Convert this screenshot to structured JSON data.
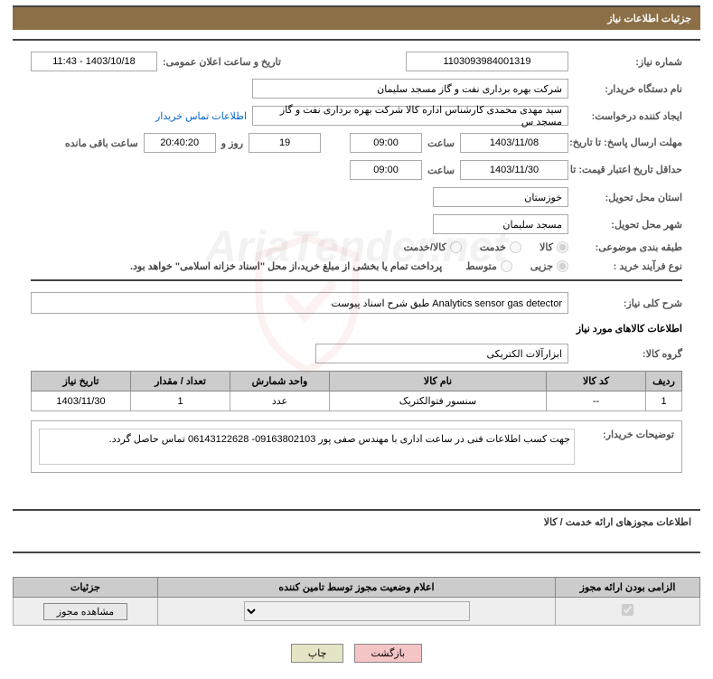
{
  "header": {
    "title": "جزئیات اطلاعات نیاز"
  },
  "watermark": "AriaTender.net",
  "fields": {
    "need_no_label": "شماره نیاز:",
    "need_no": "1103093984001319",
    "announce_label": "تاریخ و ساعت اعلان عمومی:",
    "announce": "1403/10/18 - 11:43",
    "buyer_org_label": "نام دستگاه خریدار:",
    "buyer_org": "شرکت بهره برداری نفت و گاز مسجد سلیمان",
    "requester_label": "ایجاد کننده درخواست:",
    "requester": "سید مهدی محمدی کارشناس اداره کالا  شرکت بهره برداری نفت و گاز مسجد س",
    "contact_link": "اطلاعات تماس خریدار",
    "reply_deadline_label": "مهلت ارسال پاسخ: تا تاریخ:",
    "reply_date": "1403/11/08",
    "time_label": "ساعت",
    "reply_time": "09:00",
    "days": "19",
    "days_and": "روز و",
    "countdown": "20:40:20",
    "remain": "ساعت باقی مانده",
    "price_validity_label": "حداقل تاریخ اعتبار قیمت: تا تاریخ:",
    "price_date": "1403/11/30",
    "price_time": "09:00",
    "province_label": "استان محل تحویل:",
    "province": "خوزستان",
    "city_label": "شهر محل تحویل:",
    "city": "مسجد سلیمان",
    "category_label": "طبقه بندی موضوعی:",
    "cat_goods": "کالا",
    "cat_service": "خدمت",
    "cat_both": "کالا/خدمت",
    "process_label": "نوع فرآیند خرید :",
    "proc_partial": "جزیی",
    "proc_medium": "متوسط",
    "payment_note": "پرداخت تمام یا بخشی از مبلغ خرید،از محل \"اسناد خزانه اسلامی\" خواهد بود.",
    "general_desc_label": "شرح کلی نیاز:",
    "general_desc": "طبق شرح اسناد پیوست Analytics sensor gas detector",
    "goods_info_title": "اطلاعات کالاهای مورد نیاز",
    "goods_group_label": "گروه کالا:",
    "goods_group": "ابزارآلات الکتریکی",
    "buyer_notes_label": "توضیحات خریدار:",
    "buyer_notes": "جهت کسب اطلاعات فنی در ساعت اداری با مهندس صفی پور 09163802103- 06143122628 تماس حاصل گردد."
  },
  "table": {
    "headers": {
      "row": "ردیف",
      "code": "کد کالا",
      "name": "نام کالا",
      "unit": "واحد شمارش",
      "qty": "تعداد / مقدار",
      "date": "تاریخ نیاز"
    },
    "rows": [
      {
        "row": "1",
        "code": "--",
        "name": "سنسور فتوالکتریک",
        "unit": "عدد",
        "qty": "1",
        "date": "1403/11/30"
      }
    ]
  },
  "permits": {
    "section_title": "اطلاعات مجوزهای ارائه خدمت / کالا",
    "headers": {
      "mandatory": "الزامی بودن ارائه مجوز",
      "status": "اعلام وضعیت مجوز توسط تامین کننده",
      "details": "جزئیات"
    },
    "view_btn": "مشاهده مجوز"
  },
  "footer": {
    "print": "چاپ",
    "back": "بازگشت"
  }
}
